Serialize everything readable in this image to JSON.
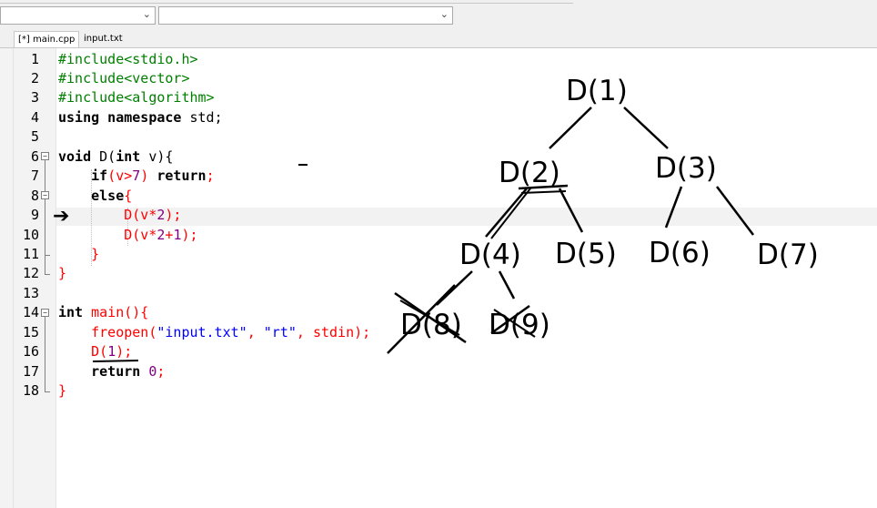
{
  "tabs": [
    "[*] main.cpp",
    "input.txt"
  ],
  "code": {
    "line_numbers": [
      "1",
      "2",
      "3",
      "4",
      "5",
      "6",
      "7",
      "8",
      "9",
      "10",
      "11",
      "12",
      "13",
      "14",
      "15",
      "16",
      "17",
      "18"
    ],
    "lines": {
      "l1": "#include<stdio.h>",
      "l2": "#include<vector>",
      "l3": "#include<algorithm>",
      "l4a": "using namespace",
      "l4b": " std;",
      "l6a": "void",
      "l6b": " D(",
      "l6c": "int",
      "l6d": " v){",
      "l7a": "    if",
      "l7b": "(v>",
      "l7c": "7",
      "l7d": ") ",
      "l7e": "return",
      "l7f": ";",
      "l8a": "    else",
      "l8b": "{",
      "l9a": "        D(v*",
      "l9b": "2",
      "l9c": ");",
      "l10a": "        D(v*",
      "l10b": "2",
      "l10c": "+",
      "l10d": "1",
      "l10e": ");",
      "l11": "    }",
      "l12": "}",
      "l14a": "int",
      "l14b": " main(){",
      "l15a": "    freopen(",
      "l15b": "\"input.txt\"",
      "l15c": ", ",
      "l15d": "\"rt\"",
      "l15e": ", stdin);",
      "l16a": "    D(",
      "l16b": "1",
      "l16c": ");",
      "l17a": "    return",
      "l17b": " 0",
      "l17c": ";",
      "l18": "}"
    }
  },
  "tree": {
    "root": "D(1)",
    "level2": [
      "D(2)",
      "D(3)"
    ],
    "level3": [
      "D(4)",
      "D(5)",
      "D(6)",
      "D(7)"
    ],
    "level4": [
      "D(8)",
      "D(9)"
    ]
  },
  "colors": {
    "preprocessor": "#008000",
    "string": "#0000ff",
    "number": "#800080",
    "brace": "#ff0000"
  }
}
